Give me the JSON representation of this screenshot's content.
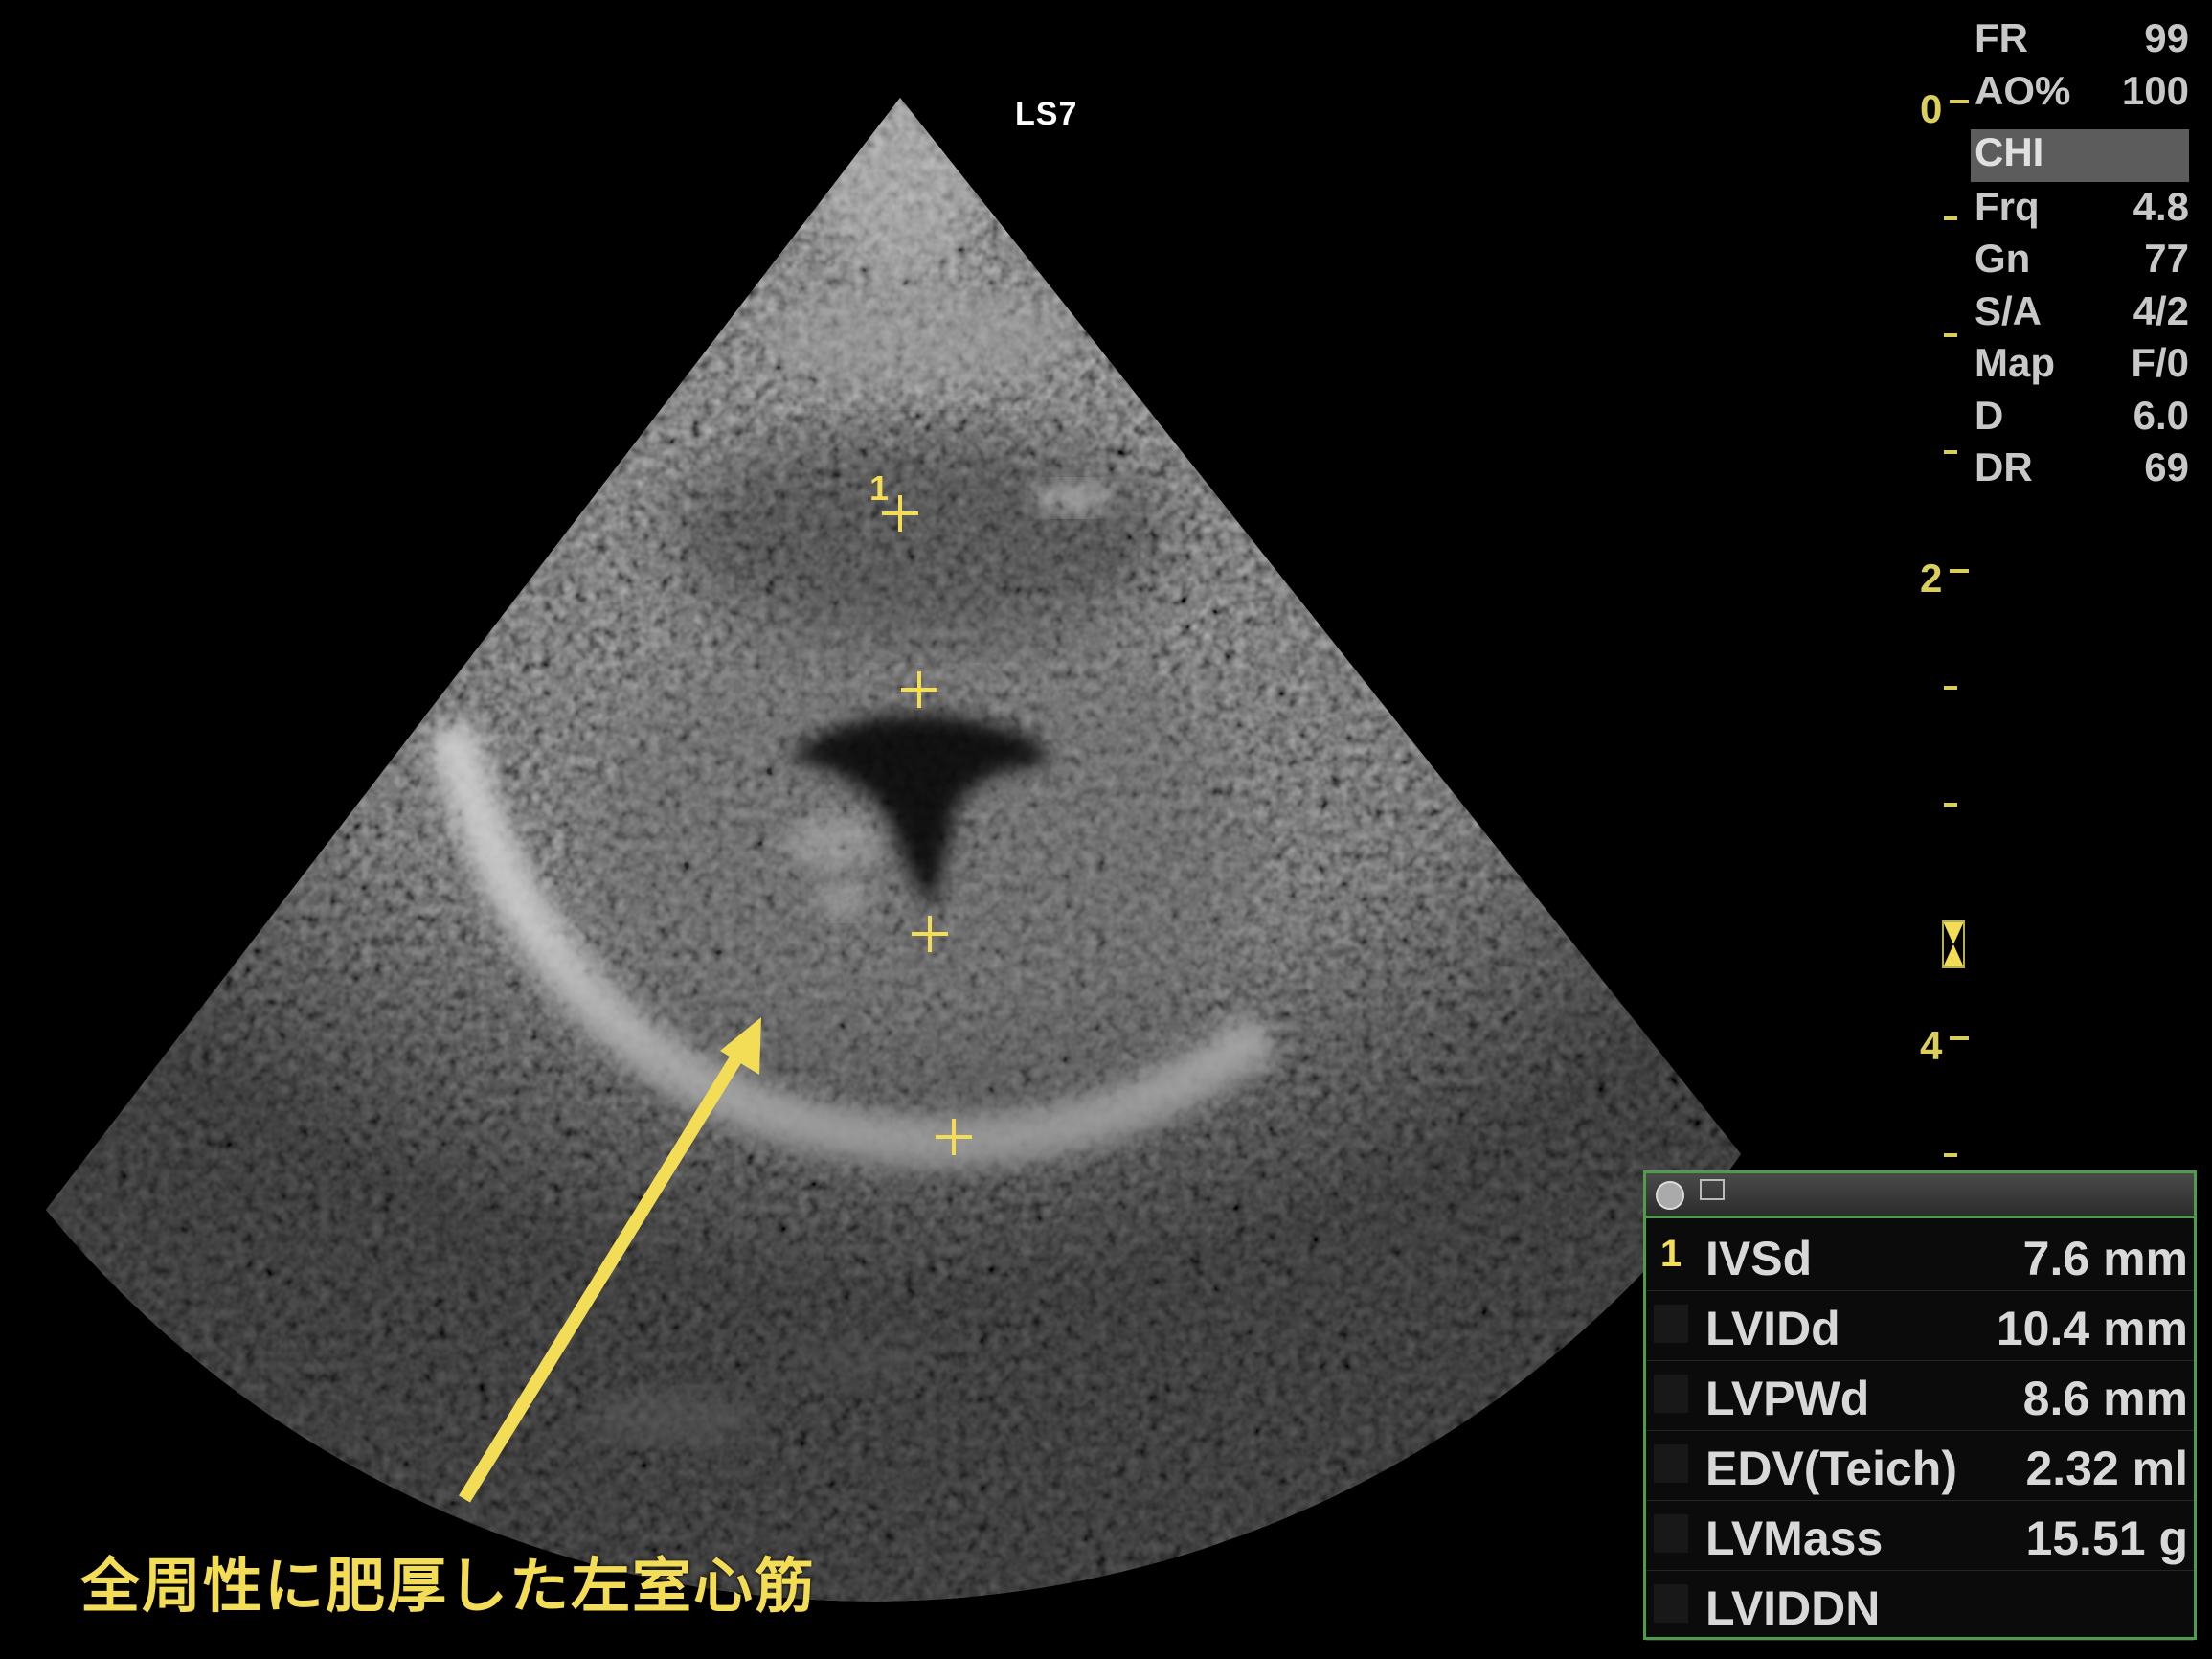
{
  "image": {
    "probe_label": "LS7",
    "cursor_label": "1",
    "caption": "全周性に肥厚した左室心筋"
  },
  "params": [
    {
      "key": "FR",
      "value": "99"
    },
    {
      "key": "AO%",
      "value": "100"
    },
    {
      "key": "CHI",
      "value": "",
      "highlight": true
    },
    {
      "key": "Frq",
      "value": "4.8"
    },
    {
      "key": "Gn",
      "value": "77"
    },
    {
      "key": "S/A",
      "value": "4/2"
    },
    {
      "key": "Map",
      "value": "F/0"
    },
    {
      "key": "D",
      "value": "6.0"
    },
    {
      "key": "DR",
      "value": "69"
    }
  ],
  "depth_scale": [
    "0",
    "2",
    "4"
  ],
  "colors": {
    "accent_yellow": "#f3dc56",
    "panel_border_green": "#4f9c4f",
    "param_text": "#c8c8c8"
  },
  "measurements": [
    {
      "index": "1",
      "name": "IVSd",
      "value": "7.6 mm"
    },
    {
      "index": "",
      "name": "LVIDd",
      "value": "10.4 mm"
    },
    {
      "index": "",
      "name": "LVPWd",
      "value": "8.6 mm"
    },
    {
      "index": "",
      "name": "EDV(Teich)",
      "value": "2.32 ml"
    },
    {
      "index": "",
      "name": "LVMass",
      "value": "15.51 g"
    },
    {
      "index": "",
      "name": "LVIDDN",
      "value": ""
    }
  ]
}
